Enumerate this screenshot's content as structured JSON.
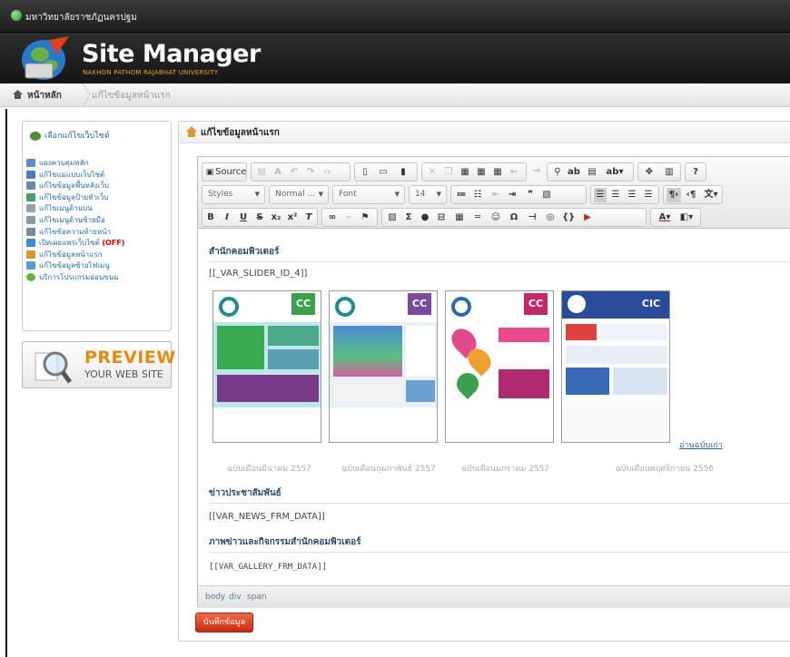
{
  "topbar": {
    "university": "มหาวิทยาลัยราชภัฏนครปฐม"
  },
  "header": {
    "title": "Site Manager",
    "subtitle": "NAKHON PATHOM RAJABHAT UNIVERSITY"
  },
  "breadcrumb": {
    "home": "หน้าหลัก",
    "current": "แก้ไขข้อมูลหน้าแรก"
  },
  "sidebar": {
    "select_site": "เลือกแก้ไขเว็บไซต์",
    "items": [
      {
        "label": "แผงควบคุมหลัก",
        "off": ""
      },
      {
        "label": "แก้ไขแม่แบบเว็บไซต์",
        "off": ""
      },
      {
        "label": "แก้ไขข้อมูลพื้นหลังเว็บ",
        "off": ""
      },
      {
        "label": "แก้ไขข้อมูลป้ายหัวเว็บ",
        "off": ""
      },
      {
        "label": "แก้ไขเมนูด้านบน",
        "off": ""
      },
      {
        "label": "แก้ไขเมนูด้านซ้ายมือ",
        "off": ""
      },
      {
        "label": "แก้ไขข้อความท้ายหน้า",
        "off": ""
      },
      {
        "label": "เปิดเผยแพร่เว็บไซต์",
        "off": "(OFF)"
      },
      {
        "label": "แก้ไขข้อมูลหน้าแรก",
        "off": ""
      },
      {
        "label": "แก้ไขข้อมูลซ้ายไฟเมนู",
        "off": ""
      },
      {
        "label": "บริการโปรแกรมอ่อนขนม",
        "off": ""
      }
    ]
  },
  "preview": {
    "title": "PREVIEW",
    "subtitle": "YOUR WEB SITE"
  },
  "panel": {
    "title": "แก้ไขข้อมูลหน้าแรก"
  },
  "toolbar": {
    "source_label": "Source",
    "styles": "Styles",
    "format": "Normal ...",
    "font": "Font",
    "size": "14"
  },
  "content": {
    "heading1": "สำนักคอมพิวเตอร์",
    "slider_var": "[[_VAR_SLIDER_ID_4]]",
    "newsletters": [
      {
        "caption": "ฉบับเดือนมีนาคม 2557",
        "badge": "CC"
      },
      {
        "caption": "ฉบับเดือนกุมภาพันธ์ 2557",
        "badge": "CC"
      },
      {
        "caption": "ฉบับเดือนมกราคม 2557",
        "badge": "CC"
      },
      {
        "caption": "ฉบับเดือนพฤศจิกายน 2556",
        "badge": "CIC"
      }
    ],
    "more_link": "อ่านฉบับเก่า",
    "heading2": "ข่าวประชาสัมพันธ์",
    "news_var": "[[VAR_NEWS_FRM_DATA]]",
    "heading3": "ภาพข่าวและกิจกรรมสำนักคอมพิวเตอร์",
    "gallery_var": "[[VAR_GALLERY_FRM_DATA]]"
  },
  "statusbar": {
    "path": [
      "body",
      "div",
      "span"
    ]
  },
  "save_button": "บันทึกข้อมูล"
}
